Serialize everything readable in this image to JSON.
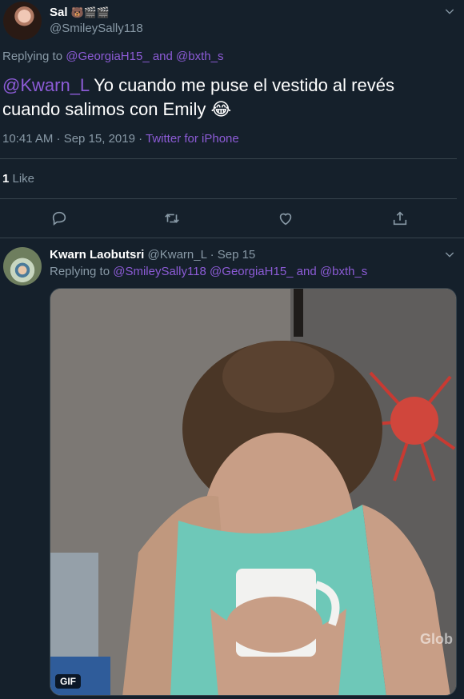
{
  "tweet": {
    "display_name": "Sal",
    "name_emojis": "🐻🎬🎬",
    "username": "@SmileySally118",
    "replying_prefix": "Replying to ",
    "replying_user1": "@GeorgiaH15_",
    "replying_and": " and ",
    "replying_user2": "@bxth_s",
    "mention": "@Kwarn_L",
    "text": " Yo cuando me puse el vestido al revés cuando salimos con Emily ",
    "text_emoji": "😂",
    "time": "10:41 AM · Sep 15, 2019 · ",
    "source": "Twitter for iPhone",
    "like_count": "1",
    "like_label": " Like"
  },
  "reply": {
    "display_name": "Kwarn Laobutsri",
    "handle_date": " @Kwarn_L · Sep 15",
    "replying_prefix": "Replying to ",
    "replying_user1": "@SmileySally118",
    "replying_user2": " @GeorgiaH15_",
    "replying_and": " and ",
    "replying_user3": "@bxth_s",
    "media_badge": "GIF",
    "watermark": "Glob"
  },
  "icons": {
    "caret": "chevron-down-icon",
    "reply": "reply-icon",
    "retweet": "retweet-icon",
    "like": "heart-icon",
    "share": "share-icon"
  },
  "colors": {
    "background": "#15202b",
    "link": "#8c5bd6",
    "secondary_text": "#8899a6",
    "divider": "#38444d"
  }
}
